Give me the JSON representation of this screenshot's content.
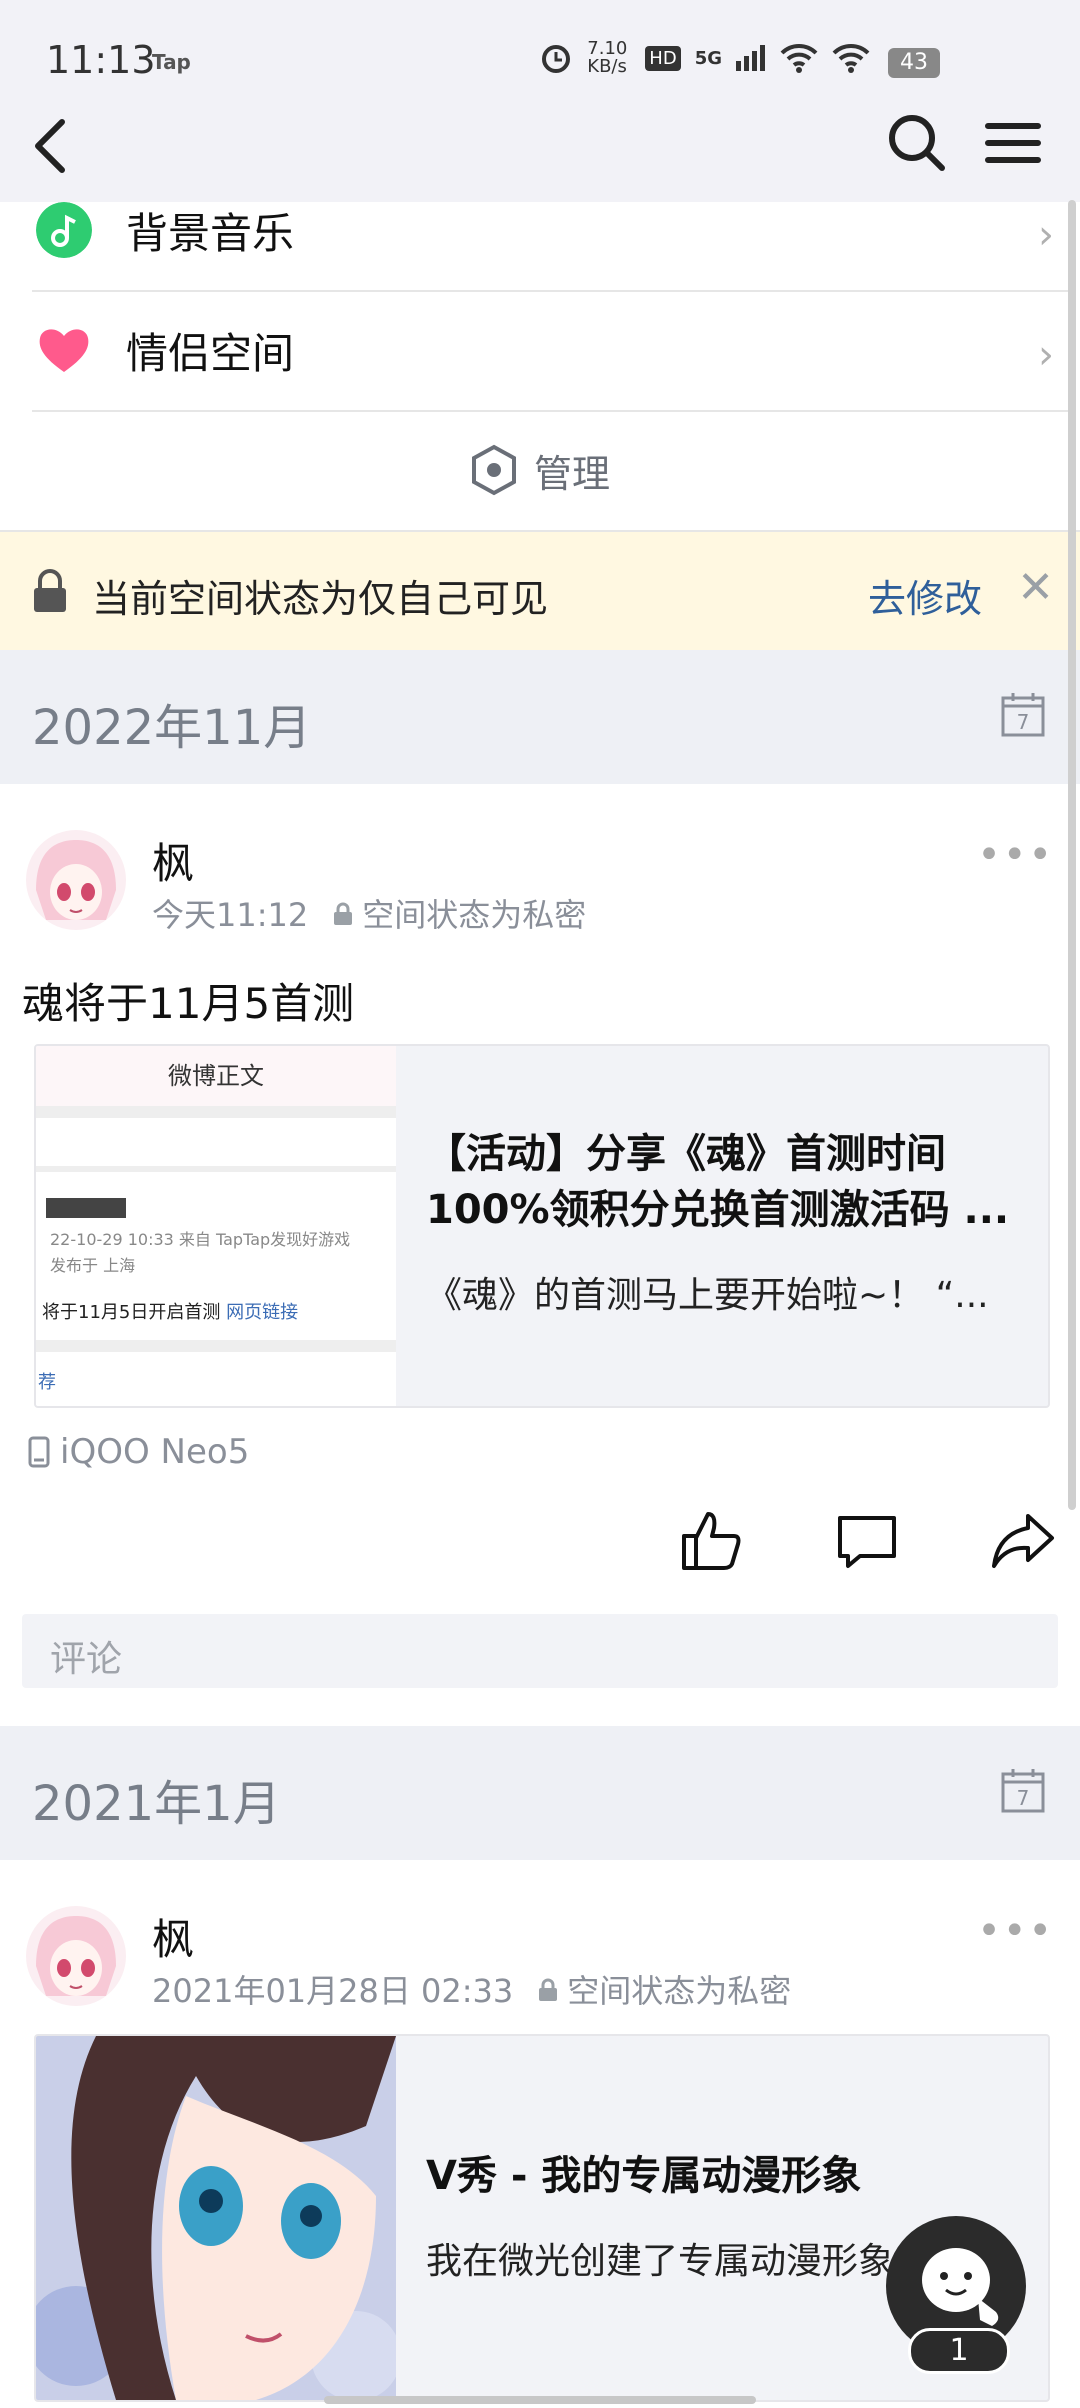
{
  "status": {
    "time": "11:13",
    "tap": "Tap",
    "net": "7.10 KB/s",
    "hd": "HD",
    "sig": "5G",
    "battery": "43"
  },
  "rows": [
    {
      "label": "背景音乐",
      "icon": "music-note-icon",
      "color": "#2ecc71"
    },
    {
      "label": "情侣空间",
      "icon": "heart-icon",
      "color": "#ff5a8c"
    }
  ],
  "manage": {
    "label": "管理"
  },
  "notice": {
    "text": "当前空间状态为仅自己可见",
    "action": "去修改"
  },
  "sections": [
    {
      "title": "2022年11月"
    },
    {
      "title": "2021年1月"
    }
  ],
  "post1": {
    "author": "枫",
    "time": "今天11:12",
    "privacy": "空间状态为私密",
    "text": "魂将于11月5首测",
    "card": {
      "title1": "【活动】分享《魂》首测时间",
      "title2": "100%领积分兑换首测激活码 ...",
      "sub": "《魂》的首测马上要开始啦~！ “...",
      "thumb": {
        "head": "微博正文",
        "date": "22-10-29 10:33  来自 TapTap发现好游戏",
        "loc": "发布于 上海",
        "body": "将于11月5日开启首测",
        "link": "网页链接",
        "rec": "荐"
      }
    },
    "device": "iQOO Neo5",
    "comment_placeholder": "评论"
  },
  "post2": {
    "author": "枫",
    "time": "2021年01月28日 02:33",
    "privacy": "空间状态为私密",
    "card": {
      "title": "V秀 - 我的专属动漫形象",
      "sub": "我在微光创建了专属动漫形象"
    }
  },
  "fab": {
    "badge": "1"
  }
}
